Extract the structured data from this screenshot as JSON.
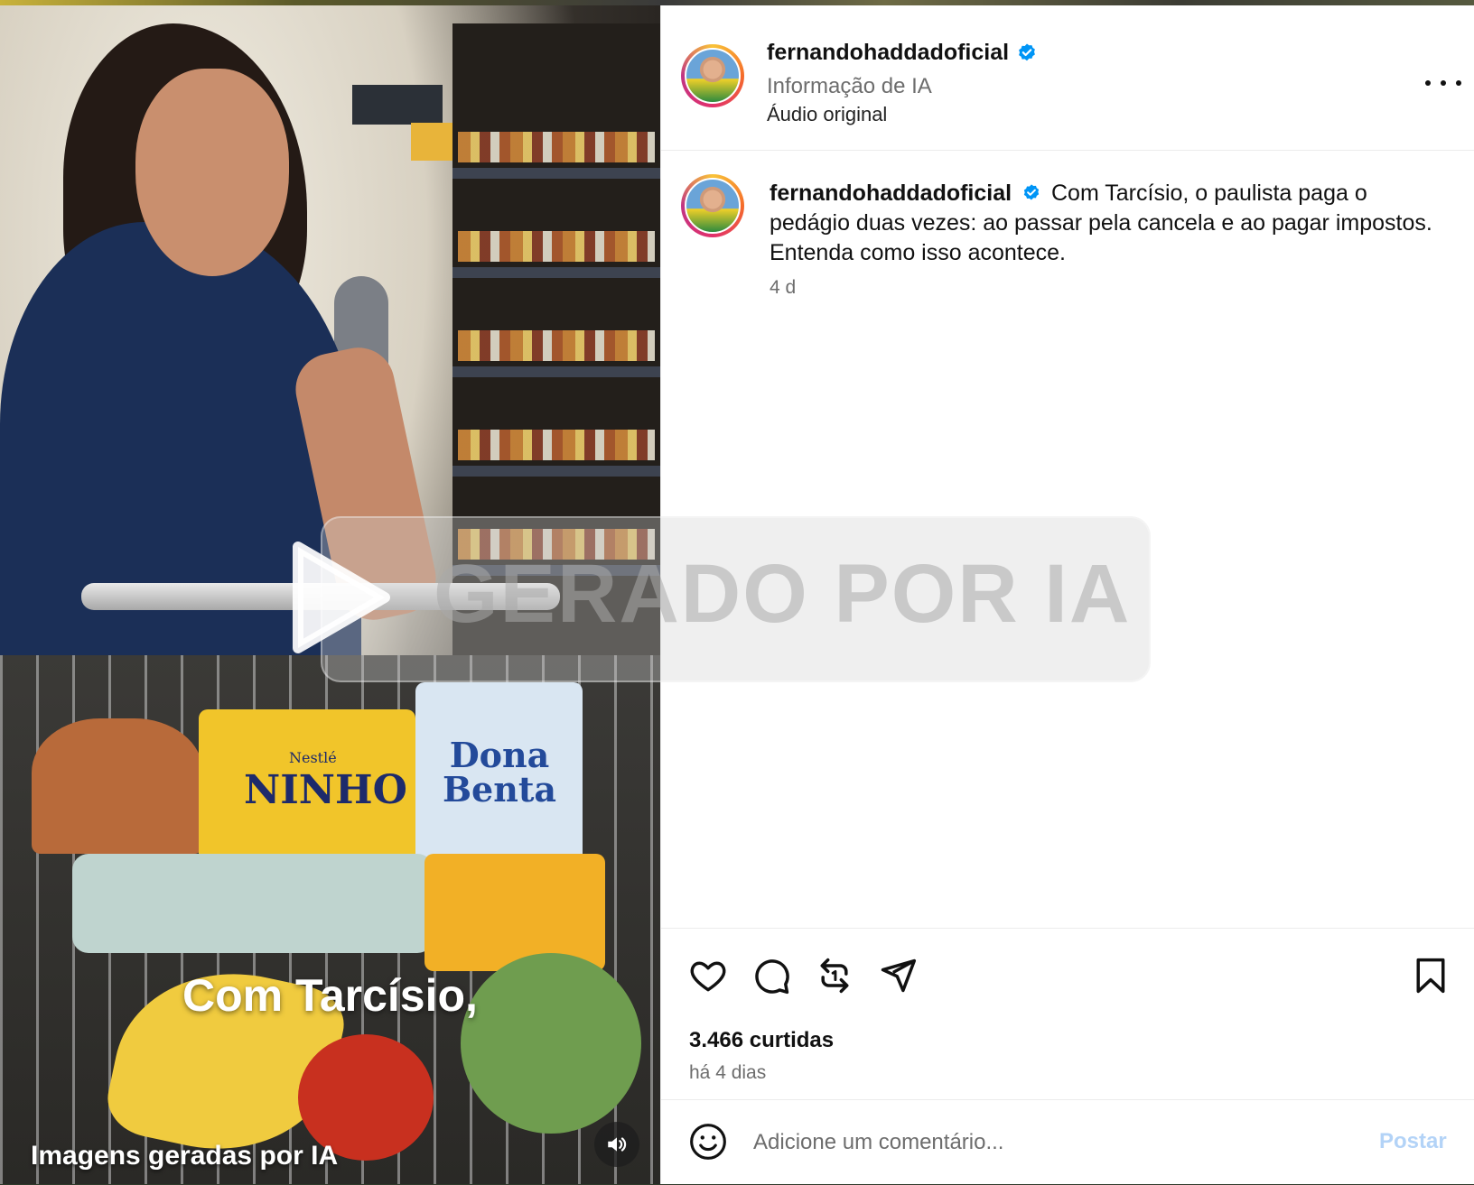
{
  "post": {
    "username": "fernandohaddadoficial",
    "verified": true,
    "ai_info": "Informação de IA",
    "audio": "Áudio original"
  },
  "media": {
    "caption_overlay": "Com Tarcísio,",
    "ai_note": "Imagens geradas por IA",
    "watermark": "GERADO POR IA",
    "product_labels": {
      "ninho_brand": "Nestlé",
      "ninho": "NINHO",
      "dona_benta": "Dona Benta"
    }
  },
  "caption": {
    "username": "fernandohaddadoficial",
    "text": "Com Tarcísio, o paulista paga o pedágio duas vezes: ao passar pela cancela e ao pagar impostos. Entenda como isso acontece.",
    "time": "4 d"
  },
  "engagement": {
    "likes": "3.466 curtidas",
    "posted_ago": "há 4 dias"
  },
  "comment_bar": {
    "placeholder": "Adicione um comentário...",
    "post_label": "Postar"
  },
  "icons": {
    "verified": "verified-badge-icon",
    "more": "more-options-icon",
    "play": "play-icon",
    "volume": "volume-icon",
    "like": "heart-icon",
    "comment": "comment-bubble-icon",
    "repost": "repost-icon",
    "share": "paper-plane-icon",
    "save": "bookmark-icon",
    "emoji": "emoji-icon"
  },
  "colors": {
    "verified_blue": "#0095f6",
    "post_button_disabled": "#b3d3f7",
    "secondary_text": "#6d6d6d"
  }
}
